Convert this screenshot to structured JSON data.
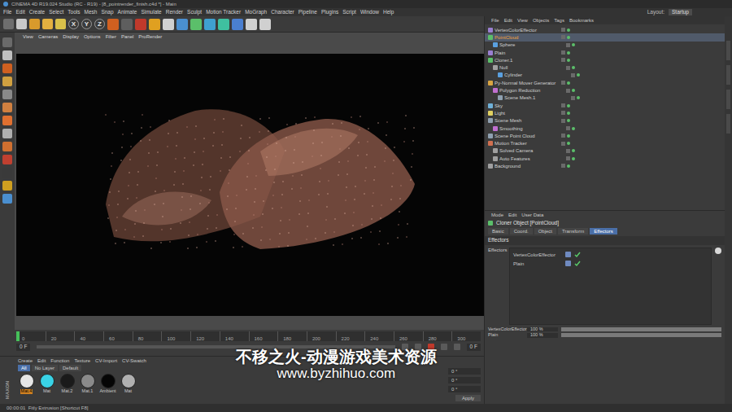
{
  "window": {
    "title": "CINEMA 4D R19.024 Studio (RC - R19) - [8_pointrender_finish.c4d *] - Main"
  },
  "menu": [
    "File",
    "Edit",
    "Create",
    "Select",
    "Tools",
    "Mesh",
    "Snap",
    "Animate",
    "Simulate",
    "Render",
    "Sculpt",
    "Motion Tracker",
    "MoGraph",
    "Character",
    "Pipeline",
    "Plugins",
    "Script",
    "Window",
    "Help"
  ],
  "layout": {
    "label": "Layout:",
    "value": "Startup"
  },
  "toolbar": {
    "axes": [
      "X",
      "Y",
      "Z"
    ]
  },
  "viewport": {
    "menu": [
      "View",
      "Cameras",
      "Display",
      "Options",
      "Filter",
      "Panel",
      "ProRender"
    ]
  },
  "timeline": {
    "ticks": [
      "0",
      "20",
      "40",
      "60",
      "80",
      "100",
      "120",
      "140",
      "160",
      "180",
      "200",
      "220",
      "240",
      "260",
      "280",
      "300"
    ],
    "current": "0 F",
    "end": "0 F",
    "level": 0.0
  },
  "materials": {
    "menu": [
      "Create",
      "Edit",
      "Function",
      "Texture",
      "CV-Import",
      "CV-Swatch"
    ],
    "tabs": [
      {
        "label": "All",
        "selected": true
      },
      {
        "label": "No Layer",
        "selected": false
      },
      {
        "label": "Default",
        "selected": false
      }
    ],
    "items": [
      {
        "name": "Mat.4",
        "color": "#e6e6e6"
      },
      {
        "name": "Mat",
        "color": "#39d3e6"
      },
      {
        "name": "Mat.2",
        "color": "#1a1a1a"
      },
      {
        "name": "Mat.1",
        "color": "#8a8a8a"
      },
      {
        "name": "Ambient",
        "color": "#050505"
      },
      {
        "name": "Mat",
        "color": "#b0b0b0"
      }
    ]
  },
  "side_logo": "MAXON",
  "coordinates": {
    "fields": [
      "0 °",
      "0 °",
      "0 °"
    ],
    "button": "Apply"
  },
  "object_manager": {
    "menu": [
      "File",
      "Edit",
      "View",
      "Objects",
      "Tags",
      "Bookmarks"
    ],
    "objects": [
      {
        "name": "VertexColorEffector",
        "depth": 0,
        "selected": false,
        "icon_color": "#9a7fd1"
      },
      {
        "name": "PointCloud",
        "depth": 0,
        "selected": true,
        "icon_color": "#5bbf6a"
      },
      {
        "name": "Sphere",
        "depth": 1,
        "selected": false,
        "icon_color": "#5aa0e0"
      },
      {
        "name": "Plain",
        "depth": 0,
        "selected": false,
        "icon_color": "#9a7fd1"
      },
      {
        "name": "Cloner.1",
        "depth": 0,
        "selected": false,
        "icon_color": "#5bbf6a"
      },
      {
        "name": "Null",
        "depth": 1,
        "selected": false,
        "icon_color": "#a0a0a0"
      },
      {
        "name": "Cylinder",
        "depth": 2,
        "selected": false,
        "icon_color": "#5aa0e0"
      },
      {
        "name": "Py-Normal Mover Generator",
        "depth": 0,
        "selected": false,
        "icon_color": "#d9a441"
      },
      {
        "name": "Polygon Reduction",
        "depth": 1,
        "selected": false,
        "icon_color": "#c070d0"
      },
      {
        "name": "Scene Mesh.1",
        "depth": 2,
        "selected": false,
        "icon_color": "#8fa0b0"
      },
      {
        "name": "Sky",
        "depth": 0,
        "selected": false,
        "icon_color": "#6fb0d8"
      },
      {
        "name": "Light",
        "depth": 0,
        "selected": false,
        "icon_color": "#e0d060"
      },
      {
        "name": "Scene Mesh",
        "depth": 0,
        "selected": false,
        "icon_color": "#8fa0b0"
      },
      {
        "name": "Smoothing",
        "depth": 1,
        "selected": false,
        "icon_color": "#c070d0"
      },
      {
        "name": "Scene Point Cloud",
        "depth": 0,
        "selected": false,
        "icon_color": "#8fa0b0"
      },
      {
        "name": "Motion Tracker",
        "depth": 0,
        "selected": false,
        "icon_color": "#d07050"
      },
      {
        "name": "Solved Camera",
        "depth": 1,
        "selected": false,
        "icon_color": "#a0a0a0"
      },
      {
        "name": "Auto Features",
        "depth": 1,
        "selected": false,
        "icon_color": "#a0a0a0"
      },
      {
        "name": "Background",
        "depth": 0,
        "selected": false,
        "icon_color": "#a0a0a0"
      }
    ]
  },
  "attributes": {
    "menu": [
      "Mode",
      "Edit",
      "User Data"
    ],
    "title": "Cloner Object [PointCloud]",
    "tabs": [
      {
        "label": "Basic",
        "selected": false
      },
      {
        "label": "Coord.",
        "selected": false
      },
      {
        "label": "Object",
        "selected": false
      },
      {
        "label": "Transform",
        "selected": false
      },
      {
        "label": "Effectors",
        "selected": true
      }
    ],
    "section": "Effectors",
    "field_label": "Effectors",
    "effectors": [
      {
        "name": "VertexColorEffector",
        "enabled": true
      },
      {
        "name": "Plain",
        "enabled": true
      }
    ],
    "strengths": [
      {
        "name": "VertexColorEffector",
        "reading": "100 %",
        "level": 1.0
      },
      {
        "name": "Plain",
        "reading": "100 %",
        "level": 1.0
      }
    ]
  },
  "status_bar": "00:00:01  Fitly Extrusion [Shortcut F8]",
  "watermark": {
    "title": "不移之火-动漫游戏美术资源",
    "url": "www.byzhihuo.com"
  }
}
